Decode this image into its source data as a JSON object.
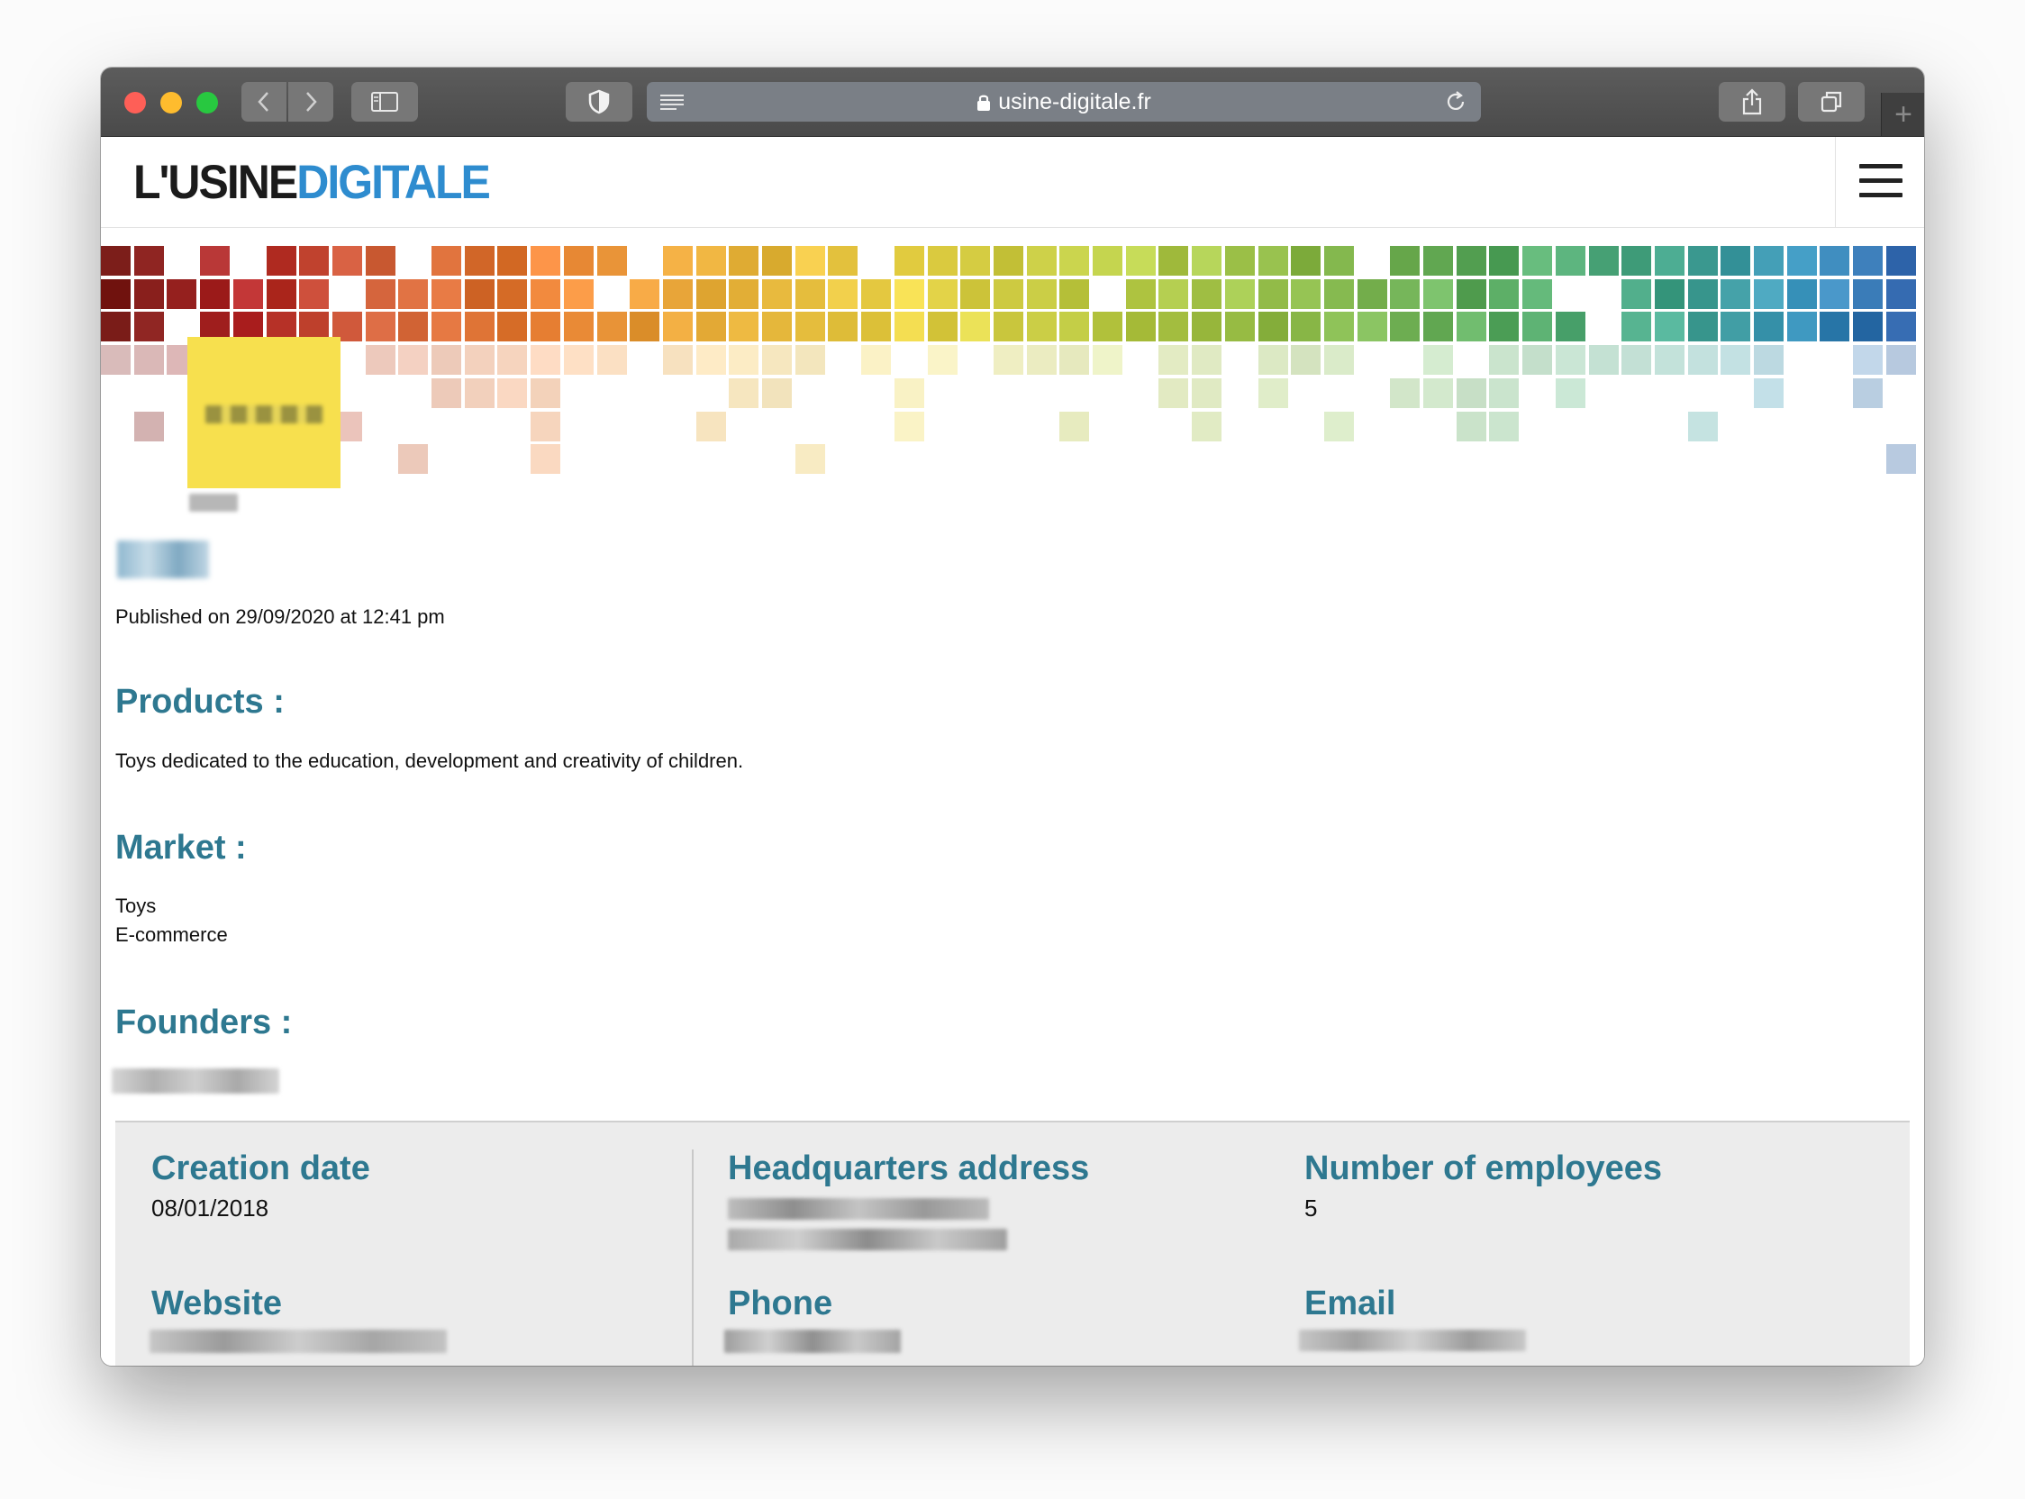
{
  "browser": {
    "url": "usine-digitale.fr"
  },
  "site": {
    "logo_part1": "L'USINE",
    "logo_part2": "DIGITALE",
    "brand_color": "#2e8ccf"
  },
  "article": {
    "published": "Published on 29/09/2020 at 12:41 pm",
    "products_title": "Products :",
    "products_text": "Toys dedicated to the education, development and creativity of children.",
    "market_title": "Market :",
    "market_items": [
      "Toys",
      "E-commerce"
    ],
    "founders_title": "Founders :"
  },
  "info": {
    "creation_label": "Creation date",
    "creation_value": "08/01/2018",
    "hq_label": "Headquarters address",
    "employees_label": "Number of employees",
    "employees_value": "5",
    "website_label": "Website",
    "phone_label": "Phone",
    "email_label": "Email"
  },
  "colors": {
    "section_title": "#2e7890",
    "infobox_bg": "#ececec"
  }
}
